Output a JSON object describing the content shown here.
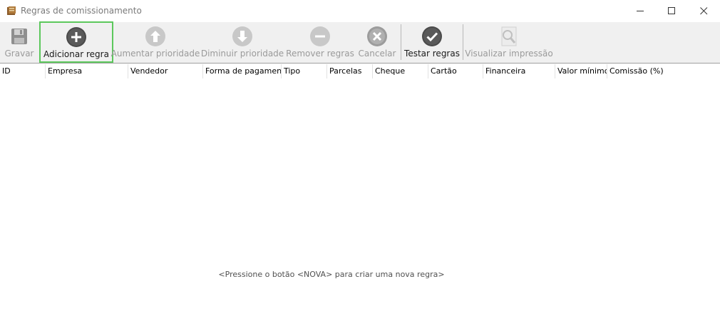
{
  "window": {
    "title": "Regras de comissionamento",
    "icon": "book-icon"
  },
  "toolbar": {
    "buttons": [
      {
        "id": "gravar",
        "label": "Gravar",
        "icon": "save-icon",
        "enabled": false
      },
      {
        "id": "adicionar",
        "label": "Adicionar regra",
        "icon": "plus-circle-icon",
        "enabled": true,
        "selected": true
      },
      {
        "id": "aumentar",
        "label": "Aumentar prioridade",
        "icon": "arrow-up-circle-icon",
        "enabled": false
      },
      {
        "id": "diminuir",
        "label": "Diminuir prioridade",
        "icon": "arrow-down-circle-icon",
        "enabled": false
      },
      {
        "id": "remover",
        "label": "Remover regras",
        "icon": "minus-circle-icon",
        "enabled": false
      },
      {
        "id": "cancelar",
        "label": "Cancelar",
        "icon": "close-circle-icon",
        "enabled": false
      },
      {
        "id": "testar",
        "label": "Testar regras",
        "icon": "check-circle-icon",
        "enabled": true
      },
      {
        "id": "visualizar",
        "label": "Visualizar impressão",
        "icon": "magnifier-icon",
        "enabled": false
      }
    ]
  },
  "grid": {
    "columns": [
      "ID",
      "Empresa",
      "Vendedor",
      "Forma de pagamento",
      "Tipo",
      "Parcelas",
      "Cheque",
      "Cartão",
      "Financeira",
      "Valor mínimo",
      "Comissão (%)"
    ],
    "rows": [],
    "empty_message": "<Pressione o botão <NOVA> para criar uma nova regra>"
  },
  "colors": {
    "selection_border": "#5cc85c",
    "toolbar_bg": "#f0f0f0"
  }
}
